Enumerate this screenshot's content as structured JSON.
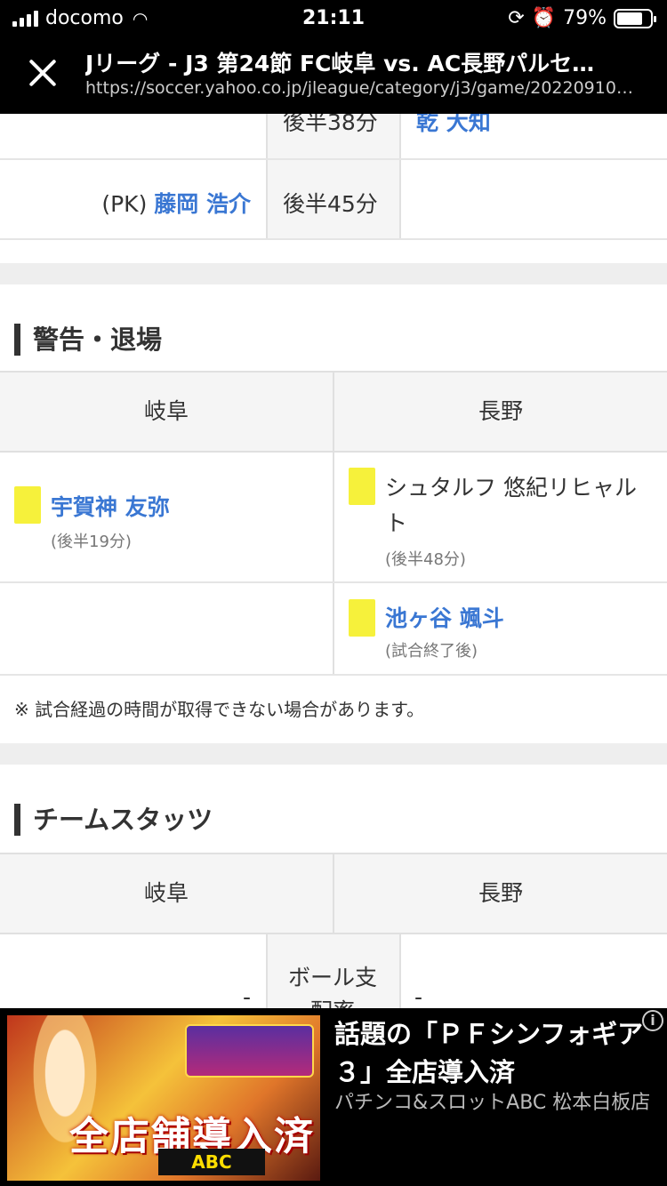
{
  "status_bar": {
    "carrier": "docomo",
    "time": "21:11",
    "battery": "79%",
    "battery_level": 0.79
  },
  "browser": {
    "title": "Jリーグ - J3 第24節 FC岐阜 vs. AC長野パルセ…",
    "url": "https://soccer.yahoo.co.jp/jleague/category/j3/game/20220910…"
  },
  "goals_partial": {
    "row1": {
      "time": "後半38分",
      "away_player": "乾 大知"
    },
    "row2": {
      "prefix": "(PK)",
      "home_player": "藤岡 浩介",
      "time": "後半45分"
    }
  },
  "cards": {
    "title": "警告・退場",
    "home_header": "岐阜",
    "away_header": "長野",
    "row1": {
      "home": {
        "name": "宇賀神 友弥",
        "time": "(後半19分)"
      },
      "away": {
        "name": "シュタルフ 悠紀リヒャルト",
        "time": "(後半48分)"
      }
    },
    "row2": {
      "away": {
        "name": "池ヶ谷 颯斗",
        "time": "(試合終了後)"
      }
    },
    "note": "※ 試合経過の時間が取得できない場合があります。"
  },
  "stats": {
    "title": "チームスタッツ",
    "home_header": "岐阜",
    "away_header": "長野",
    "row1": {
      "home": "-",
      "label": "ボール支配率",
      "away": "-"
    }
  },
  "ad": {
    "headline": "話題の「ＰＦシンフォギア３」全店導入済",
    "advertiser": "パチンコ&スロットABC 松本白板店",
    "image_text": "全店舗導入済",
    "image_logo": "ABC",
    "info_icon": "i"
  },
  "colors": {
    "link": "#3a77d3",
    "yellow_card": "#f6f13b"
  }
}
